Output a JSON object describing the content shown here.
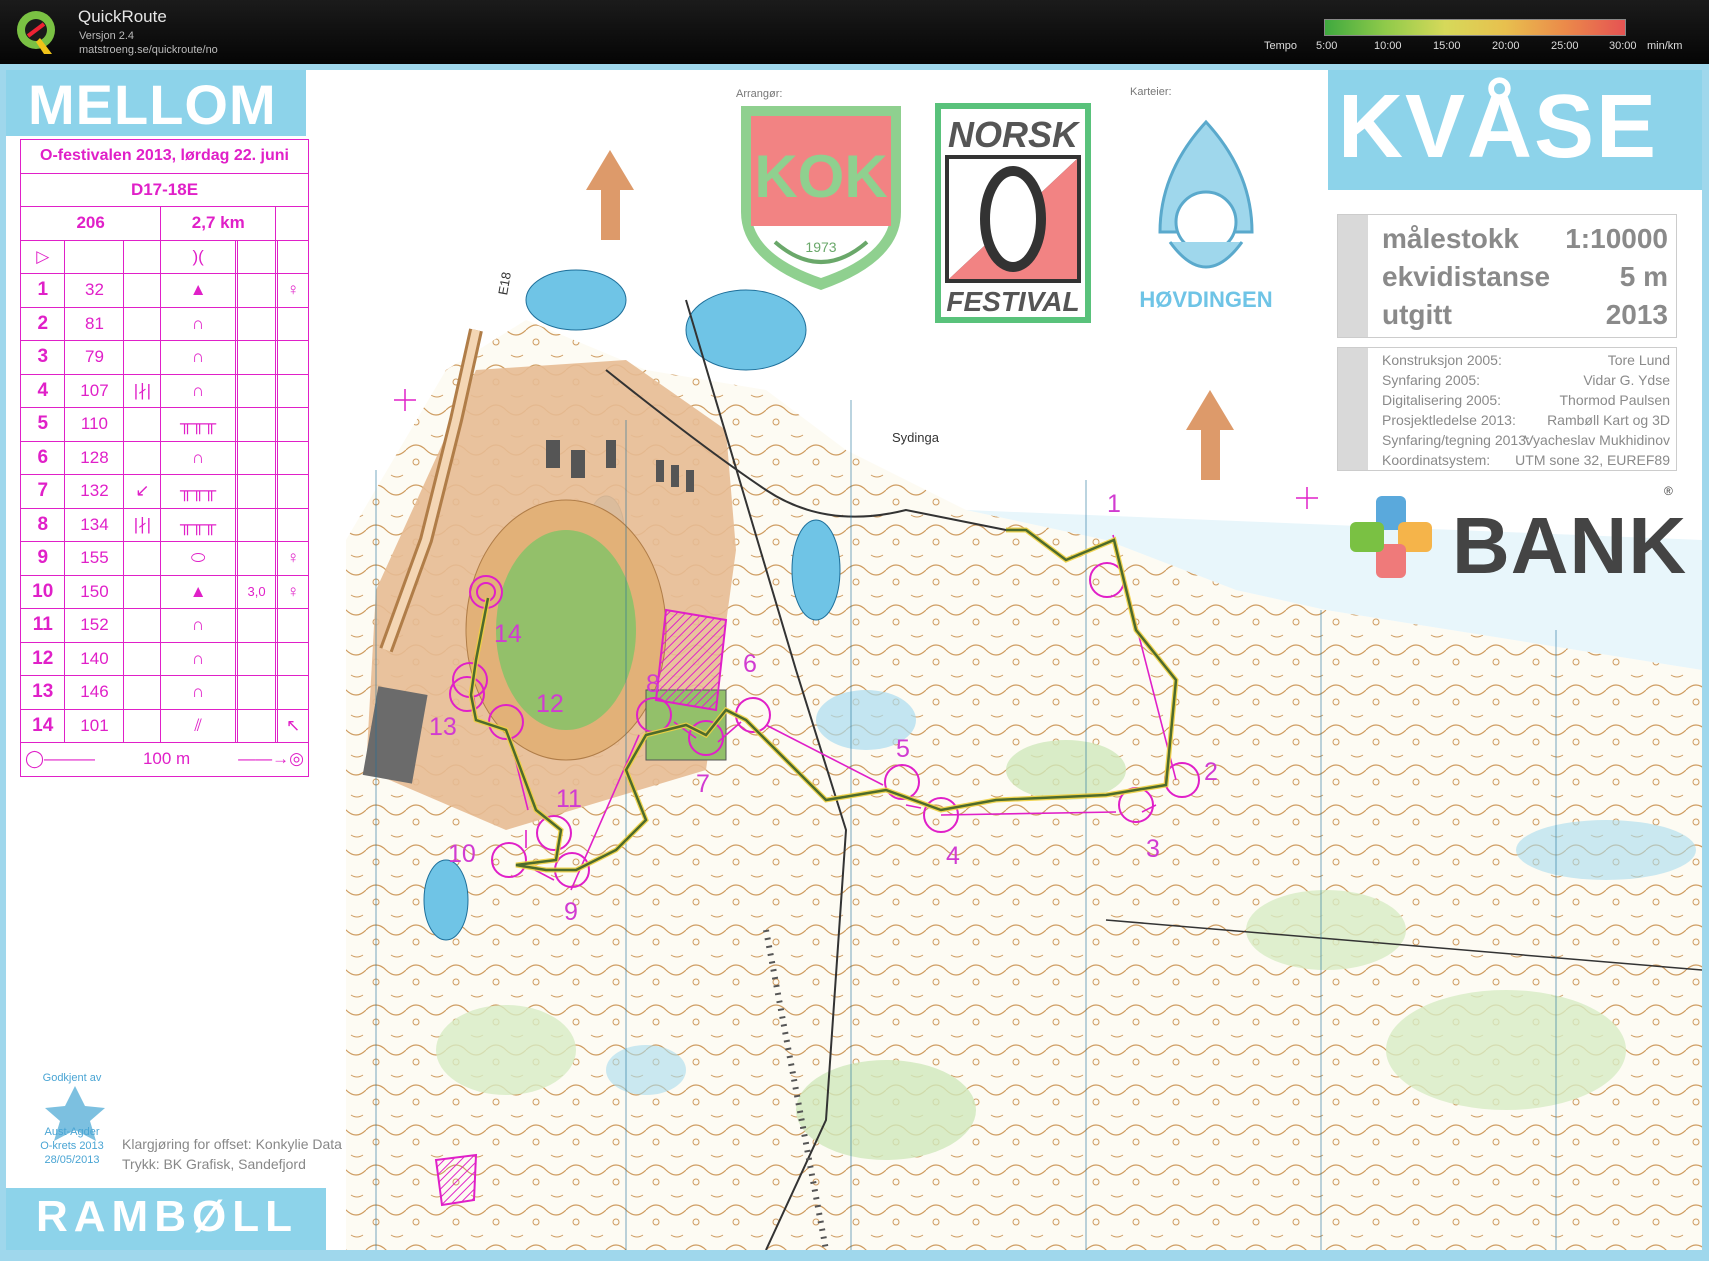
{
  "app": {
    "name": "QuickRoute",
    "version": "Versjon 2.4",
    "url": "matstroeng.se/quickroute/no"
  },
  "tempo": {
    "label": "Tempo",
    "ticks": [
      "5:00",
      "10:00",
      "15:00",
      "20:00",
      "25:00",
      "30:00"
    ],
    "unit": "min/km"
  },
  "map": {
    "class_name": "MELLOM",
    "area_name": "KVÅSE",
    "scale": {
      "key": "målestokk",
      "value": "1:10000"
    },
    "contour": {
      "key": "ekvidistanse",
      "value": "5 m"
    },
    "published": {
      "key": "utgitt",
      "value": "2013"
    },
    "credits": [
      {
        "key": "Konstruksjon 2005:",
        "value": "Tore Lund"
      },
      {
        "key": "Synfaring 2005:",
        "value": "Vidar G. Ydse"
      },
      {
        "key": "Digitalisering 2005:",
        "value": "Thormod Paulsen"
      },
      {
        "key": "Prosjektledelse 2013:",
        "value": "Rambøll Kart og 3D"
      },
      {
        "key": "Synfaring/tegning 2013:",
        "value": "Vyacheslav Mukhidinov"
      },
      {
        "key": "Koordinatsystem:",
        "value": "UTM sone 32, EUREF89"
      }
    ],
    "organizer_label": "Arrangør:",
    "owner_label": "Karteier:",
    "kok_text": "KOK",
    "kok_year": "1973",
    "norsk_top": "NORSK",
    "norsk_bottom": "FESTIVAL",
    "hovdingen": "HØVDINGEN",
    "bank": "BANK",
    "bank_reg": "®",
    "ramboll": "RAMBØLL",
    "print_notes": [
      "Klargjøring for offset: Konkylie Data",
      "Trykk: BK Grafisk, Sandefjord"
    ],
    "approval": [
      "Godkjent av",
      "Aust-Agder",
      "O-krets 2013",
      "28/05/2013"
    ],
    "place_names": [
      "Sydinga",
      "E18"
    ],
    "control_numbers": [
      "1",
      "2",
      "3",
      "4",
      "5",
      "6",
      "7",
      "8",
      "9",
      "10",
      "11",
      "12",
      "13",
      "14"
    ]
  },
  "course": {
    "event": "O-festivalen 2013, lørdag 22. juni",
    "class": "D17-18E",
    "course_no": "206",
    "length": "2,7 km",
    "start_symbol": "▷",
    "start_feature": ")(",
    "controls": [
      {
        "n": "1",
        "code": "32",
        "feature": "▲",
        "extra": "",
        "dim": "",
        "info": "♀"
      },
      {
        "n": "2",
        "code": "81",
        "feature": "∩",
        "extra": "",
        "dim": "",
        "info": ""
      },
      {
        "n": "3",
        "code": "79",
        "feature": "∩",
        "extra": "",
        "dim": "",
        "info": ""
      },
      {
        "n": "4",
        "code": "107",
        "feature": "∩",
        "extra": "|∤|",
        "dim": "",
        "info": ""
      },
      {
        "n": "5",
        "code": "110",
        "feature": "╥╥╥",
        "extra": "",
        "dim": "",
        "info": ""
      },
      {
        "n": "6",
        "code": "128",
        "feature": "∩",
        "extra": "",
        "dim": "",
        "info": ""
      },
      {
        "n": "7",
        "code": "132",
        "feature": "╥╥╥",
        "extra": "↙",
        "dim": "",
        "info": ""
      },
      {
        "n": "8",
        "code": "134",
        "feature": "╥╥╥",
        "extra": "|∤|",
        "dim": "",
        "info": ""
      },
      {
        "n": "9",
        "code": "155",
        "feature": "⬭",
        "extra": "",
        "dim": "",
        "info": "♀"
      },
      {
        "n": "10",
        "code": "150",
        "feature": "▲",
        "extra": "",
        "dim": "3,0",
        "info": "♀"
      },
      {
        "n": "11",
        "code": "152",
        "feature": "∩",
        "extra": "",
        "dim": "",
        "info": ""
      },
      {
        "n": "12",
        "code": "140",
        "feature": "∩",
        "extra": "",
        "dim": "",
        "info": ""
      },
      {
        "n": "13",
        "code": "146",
        "feature": "∩",
        "extra": "",
        "dim": "",
        "info": ""
      },
      {
        "n": "14",
        "code": "101",
        "feature": "⫽",
        "extra": "",
        "dim": "",
        "info": "↖"
      }
    ],
    "finish": "100 m"
  },
  "colors": {
    "course": "#e020c8",
    "route": "#4d6b2b",
    "frame": "#9fd7ec",
    "water": "#6fc4e6"
  }
}
